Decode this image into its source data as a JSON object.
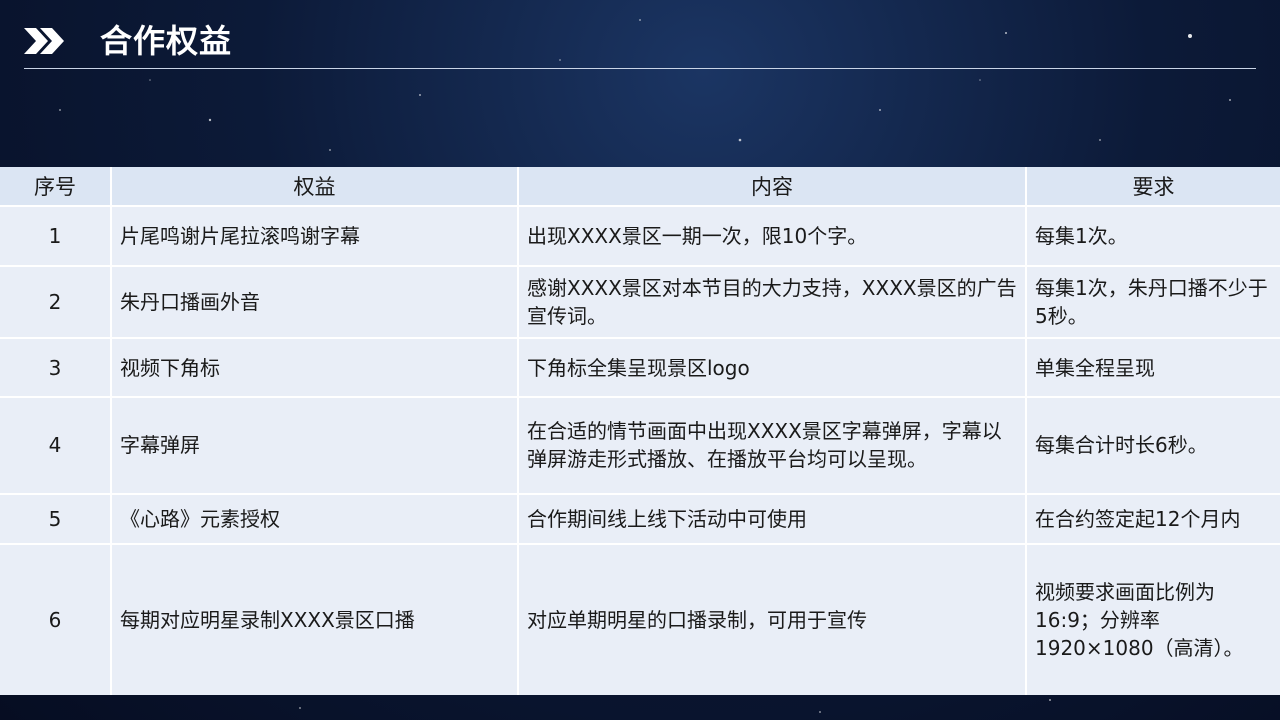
{
  "header": {
    "title": "合作权益",
    "icon": "double-chevron-right-icon"
  },
  "table": {
    "columns": [
      "序号",
      "权益",
      "内容",
      "要求"
    ],
    "rows": [
      {
        "no": "1",
        "right": "片尾鸣谢片尾拉滚鸣谢字幕",
        "content": "出现XXXX景区一期一次，限10个字。",
        "requirement": "每集1次。"
      },
      {
        "no": "2",
        "right": "朱丹口播画外音",
        "content": "感谢XXXX景区对本节目的大力支持，XXXX景区的广告宣传词。",
        "requirement": "每集1次，朱丹口播不少于5秒。"
      },
      {
        "no": "3",
        "right": "视频下角标",
        "content": "下角标全集呈现景区logo",
        "requirement": "单集全程呈现"
      },
      {
        "no": "4",
        "right": "字幕弹屏",
        "content": "在合适的情节画面中出现XXXX景区字幕弹屏，字幕以弹屏游走形式播放、在播放平台均可以呈现。",
        "requirement": "每集合计时长6秒。"
      },
      {
        "no": "5",
        "right": "《心路》元素授权",
        "content": "合作期间线上线下活动中可使用",
        "requirement": "在合约签定起12个月内"
      },
      {
        "no": "6",
        "right": "每期对应明星录制XXXX景区口播",
        "content": "对应单期明星的口播录制，可用于宣传",
        "requirement": "视频要求画面比例为16:9；分辨率1920×1080（高清）。"
      }
    ]
  },
  "colors": {
    "background": "#0c1a38",
    "header_row": "#dbe5f3",
    "body_row": "#e9eef7",
    "title": "#ffffff"
  }
}
